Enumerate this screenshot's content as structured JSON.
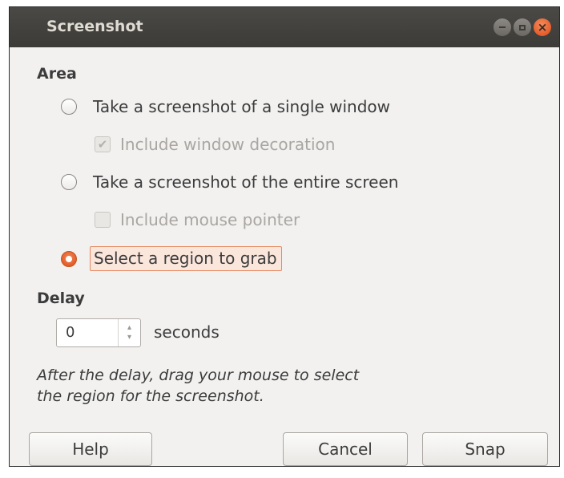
{
  "window": {
    "title": "Screenshot"
  },
  "area": {
    "heading": "Area",
    "options": [
      {
        "label": "Take a screenshot of a single window",
        "selected": false
      },
      {
        "label": "Take a screenshot of the entire screen",
        "selected": false
      },
      {
        "label": "Select a region to grab",
        "selected": true
      }
    ],
    "include_window_decoration": {
      "label": "Include window decoration",
      "checked": true,
      "enabled": false
    },
    "include_mouse_pointer": {
      "label": "Include mouse pointer",
      "checked": false,
      "enabled": false
    }
  },
  "delay": {
    "heading": "Delay",
    "value": "0",
    "unit": "seconds"
  },
  "hint": {
    "line1": "After the delay, drag your mouse to select",
    "line2": "the region for the screenshot."
  },
  "buttons": {
    "help": "Help",
    "cancel": "Cancel",
    "snap": "Snap"
  },
  "icons": {
    "minimize": "minimize-icon",
    "maximize": "maximize-icon",
    "close": "close-icon",
    "check": "checkmark-icon",
    "spin": "spin-arrows-icon"
  },
  "colors": {
    "titlebar": "#3c3b37",
    "accent": "#dd4814",
    "window_bg": "#f2f1f0"
  }
}
